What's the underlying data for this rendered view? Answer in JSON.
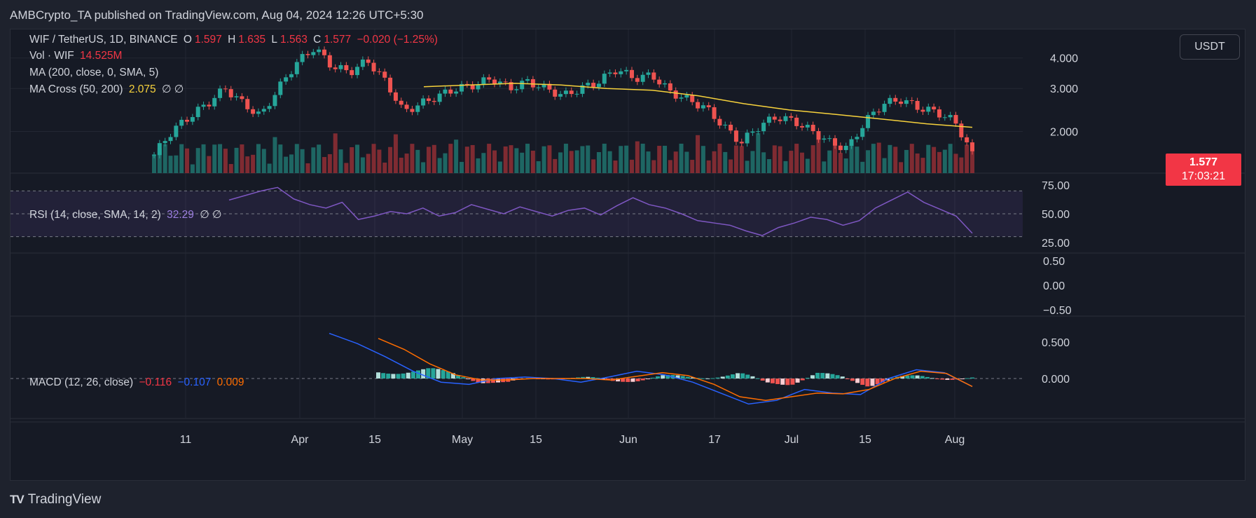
{
  "header": {
    "published": "AMBCrypto_TA published on TradingView.com, Aug 04, 2024 12:26 UTC+5:30"
  },
  "legend": {
    "symbol": "WIF / TetherUS, 1D, BINANCE",
    "o_label": "O",
    "o": "1.597",
    "h_label": "H",
    "h": "1.635",
    "l_label": "L",
    "l": "1.563",
    "c_label": "C",
    "c": "1.577",
    "change": "−0.020 (−1.25%)",
    "vol_label": "Vol · WIF",
    "vol": "14.525M",
    "ma_label": "MA (200, close, 0, SMA, 5)",
    "macross_label": "MA Cross (50, 200)",
    "macross_value": "2.075",
    "macross_extra": "∅ ∅",
    "rsi_label": "RSI (14, close, SMA, 14, 2)",
    "rsi_value": "32.29",
    "rsi_extra": "∅ ∅",
    "macd_label": "MACD (12, 26, close)",
    "macd_v1": "−0.116",
    "macd_v2": "−0.107",
    "macd_v3": "0.009"
  },
  "currency_button": "USDT",
  "price_tag": {
    "price": "1.577",
    "countdown": "17:03:21"
  },
  "footer": {
    "brand": "TradingView",
    "logo": "TV"
  },
  "colors": {
    "up": "#26a69a",
    "down": "#ef5350",
    "ma": "#f7d23c",
    "rsi": "#7e57c2",
    "macd": "#2962ff",
    "signal": "#ff6d00"
  },
  "chart_data": {
    "type": "candlestick",
    "x_axis_labels": [
      "11",
      "Apr",
      "15",
      "May",
      "15",
      "Jun",
      "17",
      "Jul",
      "15",
      "Aug"
    ],
    "price_axis_labels": [
      "4.000",
      "3.000",
      "2.000"
    ],
    "price_scale": "log",
    "price_closes_sampled": [
      1.6,
      2.0,
      2.3,
      2.6,
      3.0,
      2.6,
      2.3,
      3.0,
      3.8,
      4.4,
      3.7,
      3.5,
      3.9,
      3.2,
      2.4,
      2.6,
      2.8,
      3.0,
      3.1,
      3.3,
      3.0,
      3.2,
      3.0,
      2.8,
      3.0,
      3.2,
      3.6,
      3.3,
      3.4,
      2.9,
      2.7,
      2.5,
      2.1,
      1.8,
      2.1,
      2.3,
      2.2,
      2.0,
      1.8,
      1.7,
      2.2,
      2.6,
      2.7,
      2.5,
      2.4,
      2.2,
      1.6
    ],
    "ma200_sampled": [
      3.05,
      3.1,
      3.15,
      3.1,
      3.0,
      2.95,
      2.8,
      2.6,
      2.45,
      2.35,
      2.25,
      2.15,
      2.08
    ],
    "rsi": {
      "axis_labels": [
        "75.00",
        "50.00",
        "25.00"
      ],
      "band": [
        30,
        70
      ],
      "values_sampled": [
        62,
        66,
        70,
        73,
        63,
        58,
        55,
        60,
        45,
        48,
        52,
        50,
        55,
        48,
        51,
        58,
        54,
        50,
        56,
        52,
        48,
        53,
        55,
        49,
        57,
        64,
        58,
        55,
        50,
        44,
        42,
        40,
        35,
        31,
        38,
        42,
        47,
        45,
        40,
        44,
        55,
        62,
        69,
        60,
        54,
        48,
        33
      ]
    },
    "empty_pane_axis_labels": [
      "0.50",
      "0.00",
      "−0.50"
    ],
    "macd": {
      "axis_labels": [
        "0.500",
        "0.000"
      ],
      "macd_sampled": [
        0.62,
        0.48,
        0.3,
        0.1,
        -0.05,
        -0.08,
        0.0,
        0.02,
        0.0,
        -0.05,
        0.02,
        0.1,
        0.05,
        -0.05,
        -0.2,
        -0.35,
        -0.3,
        -0.15,
        -0.2,
        -0.22,
        0.0,
        0.12,
        0.08,
        -0.11
      ],
      "signal_sampled": [
        0.55,
        0.4,
        0.2,
        0.05,
        -0.02,
        -0.02,
        0.0,
        0.0,
        0.0,
        -0.02,
        0.03,
        0.08,
        0.04,
        -0.08,
        -0.25,
        -0.3,
        -0.25,
        -0.2,
        -0.21,
        -0.15,
        0.0,
        0.1,
        0.07,
        -0.11
      ]
    }
  }
}
